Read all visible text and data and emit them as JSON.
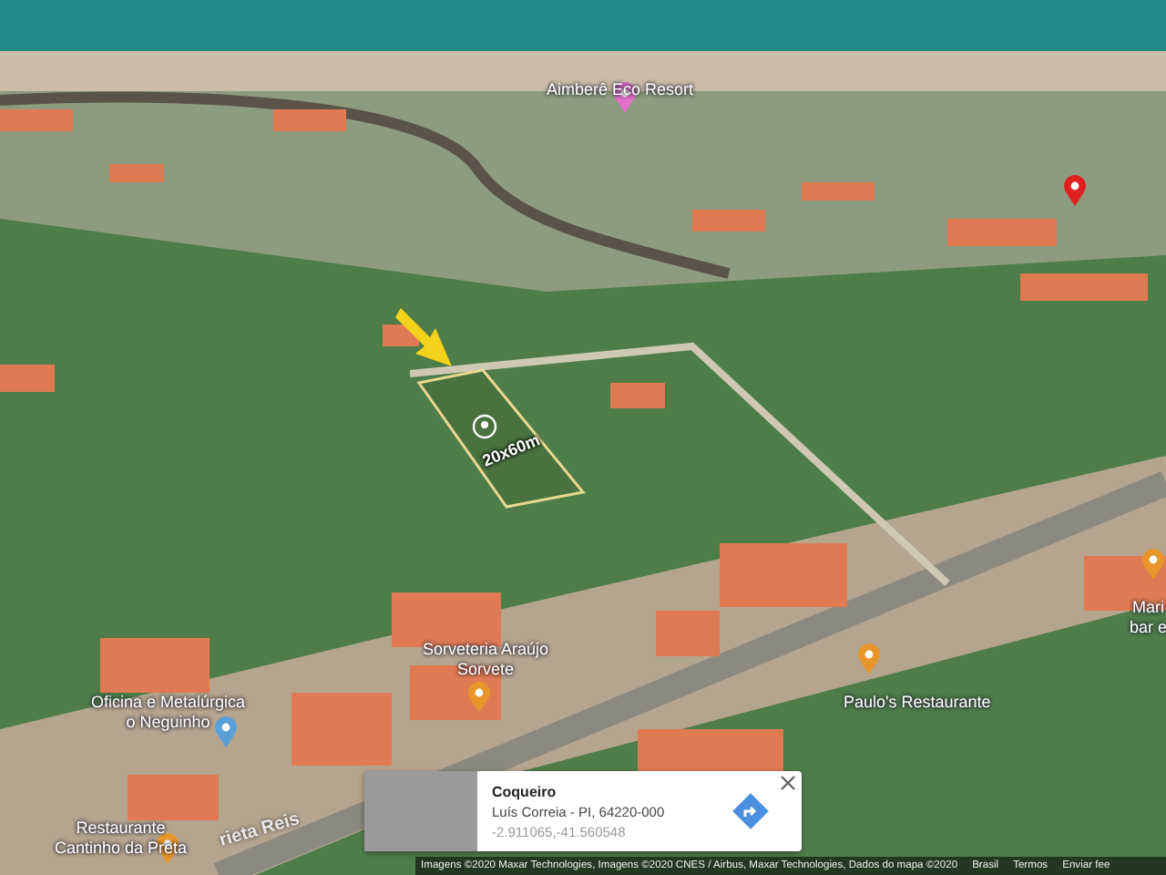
{
  "map": {
    "places": [
      {
        "kind": "pin",
        "color": "#e070c8",
        "lines": [
          "Aimberê Eco Resort"
        ]
      },
      {
        "kind": "pin",
        "color": "#e8962c",
        "lines": [
          "Sorveteria Araújo",
          "Sorvete"
        ]
      },
      {
        "kind": "pin",
        "color": "#5aa0d8",
        "lines": [
          "Oficina e Metalúrgica",
          "o Neguinho"
        ]
      },
      {
        "kind": "pin",
        "color": "#e8962c",
        "lines": [
          "Restaurante",
          "Cantinho da Preta"
        ]
      },
      {
        "kind": "pin",
        "color": "#e8962c",
        "lines": [
          "Paulo's Restaurante"
        ]
      },
      {
        "kind": "pin",
        "color": "#e8962c",
        "lines": [
          "Mari",
          "bar e"
        ]
      },
      {
        "kind": "marker",
        "color": "#e02020"
      }
    ],
    "streets": [
      "rieta Reis"
    ],
    "plot": {
      "label": "20x60m"
    },
    "info_card": {
      "title": "Coqueiro",
      "address": "Luís Correia - PI, 64220-000",
      "coordinates": "-2.911065,-41.560548"
    },
    "attribution": {
      "text": "Imagens ©2020 Maxar Technologies, Imagens ©2020 CNES / Airbus, Maxar Technologies, Dados do mapa ©2020",
      "links": [
        "Brasil",
        "Termos",
        "Enviar fee"
      ]
    }
  }
}
